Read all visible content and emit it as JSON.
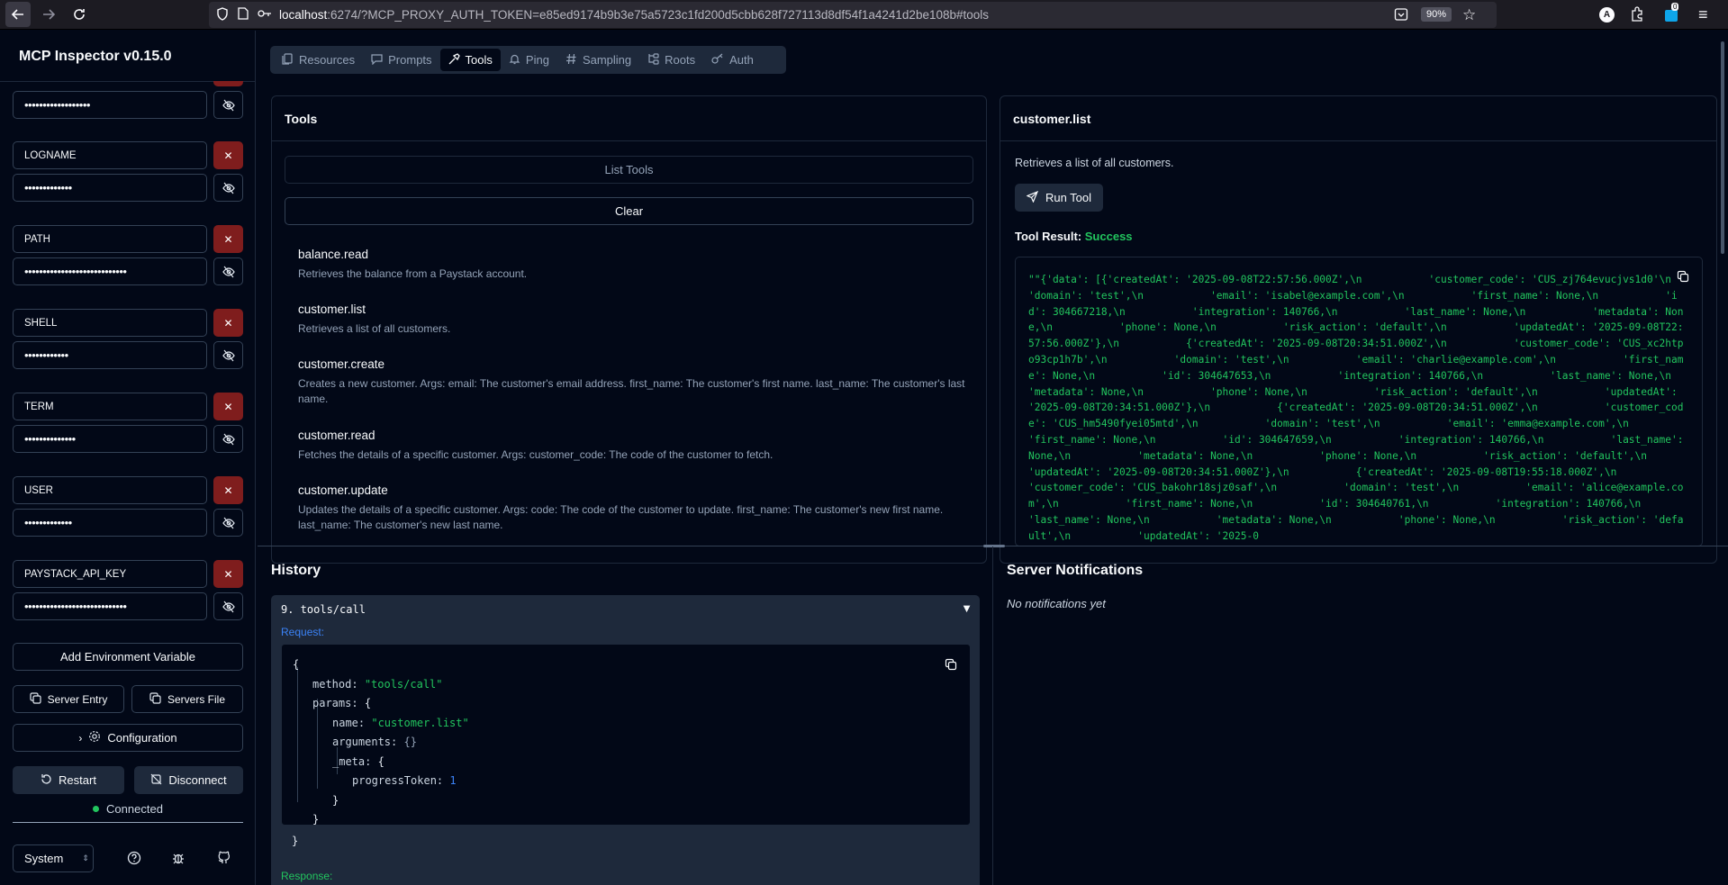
{
  "browser": {
    "url_host": "localhost",
    "url_rest": ":6274/?MCP_PROXY_AUTH_TOKEN=e85ed9174b9b3e75a5723c1fd200d5cbb628f727113d8df54f1a4241d2be108b#tools",
    "zoom": "90%",
    "ext_badge": "0"
  },
  "sidebar": {
    "title": "MCP Inspector v0.15.0",
    "env": [
      {
        "key": "",
        "value": "••••••••••••••••••"
      },
      {
        "key": "LOGNAME",
        "value": "•••••••••••••"
      },
      {
        "key": "PATH",
        "value": "••••••••••••••••••••••••••••"
      },
      {
        "key": "SHELL",
        "value": "••••••••••••"
      },
      {
        "key": "TERM",
        "value": "••••••••••••••"
      },
      {
        "key": "USER",
        "value": "•••••••••••••"
      },
      {
        "key": "PAYSTACK_API_KEY",
        "value": "••••••••••••••••••••••••••••"
      }
    ],
    "add_env": "Add Environment Variable",
    "server_entry": "Server Entry",
    "servers_file": "Servers File",
    "configuration": "Configuration",
    "restart": "Restart",
    "disconnect": "Disconnect",
    "status": "Connected",
    "theme": "System"
  },
  "tabs": [
    {
      "label": "Resources",
      "icon": "files-icon"
    },
    {
      "label": "Prompts",
      "icon": "message-icon"
    },
    {
      "label": "Tools",
      "icon": "hammer-icon"
    },
    {
      "label": "Ping",
      "icon": "bell-icon"
    },
    {
      "label": "Sampling",
      "icon": "hash-icon"
    },
    {
      "label": "Roots",
      "icon": "folder-tree-icon"
    },
    {
      "label": "Auth",
      "icon": "key-icon"
    }
  ],
  "tools_panel": {
    "title": "Tools",
    "list_tools": "List Tools",
    "clear": "Clear",
    "items": [
      {
        "name": "balance.read",
        "desc": "Retrieves the balance from a Paystack account."
      },
      {
        "name": "customer.list",
        "desc": "Retrieves a list of all customers."
      },
      {
        "name": "customer.create",
        "desc": "Creates a new customer. Args: email: The customer's email address. first_name: The customer's first name. last_name: The customer's last name."
      },
      {
        "name": "customer.read",
        "desc": "Fetches the details of a specific customer. Args: customer_code: The code of the customer to fetch."
      },
      {
        "name": "customer.update",
        "desc": "Updates the details of a specific customer. Args: code: The code of the customer to update. first_name: The customer's new first name. last_name: The customer's new last name."
      }
    ]
  },
  "detail_panel": {
    "title": "customer.list",
    "description": "Retrieves a list of all customers.",
    "run_tool": "Run Tool",
    "result_label": "Tool Result:",
    "result_status": "Success",
    "result_text": "\"\"{'data': [{'createdAt': '2025-09-08T22:57:56.000Z',\\n           'customer_code': 'CUS_zj764evucjvs1d0'\\n           'domain': 'test',\\n           'email': 'isabel@example.com',\\n           'first_name': None,\\n           'id': 304667218,\\n           'integration': 140766,\\n           'last_name': None,\\n           'metadata': None,\\n           'phone': None,\\n           'risk_action': 'default',\\n           'updatedAt': '2025-09-08T22:57:56.000Z'},\\n           {'createdAt': '2025-09-08T20:34:51.000Z',\\n           'customer_code': 'CUS_xc2htpo93cp1h7b',\\n           'domain': 'test',\\n           'email': 'charlie@example.com',\\n           'first_name': None,\\n           'id': 304647653,\\n           'integration': 140766,\\n           'last_name': None,\\n           'metadata': None,\\n           'phone': None,\\n           'risk_action': 'default',\\n           'updatedAt': '2025-09-08T20:34:51.000Z'},\\n           {'createdAt': '2025-09-08T20:34:51.000Z',\\n           'customer_code': 'CUS_hm5490fyei05mtd',\\n           'domain': 'test',\\n           'email': 'emma@example.com',\\n           'first_name': None,\\n           'id': 304647659,\\n           'integration': 140766,\\n           'last_name': None,\\n           'metadata': None,\\n           'phone': None,\\n           'risk_action': 'default',\\n           'updatedAt': '2025-09-08T20:34:51.000Z'},\\n           {'createdAt': '2025-09-08T19:55:18.000Z',\\n           'customer_code': 'CUS_bakohr18sjz0saf',\\n           'domain': 'test',\\n           'email': 'alice@example.com',\\n           'first_name': None,\\n           'id': 304640761,\\n           'integration': 140766,\\n           'last_name': None,\\n           'metadata': None,\\n           'phone': None,\\n           'risk_action': 'default',\\n           'updatedAt': '2025-0"
  },
  "history": {
    "title": "History",
    "entry": "9. tools/call",
    "request_label": "Request:",
    "response_label": "Response:",
    "json": {
      "open": "{",
      "method_key": "method:",
      "method_val": "\"tools/call\"",
      "params_key": "params:",
      "brace_open": "{",
      "name_key": "name:",
      "name_val": "\"customer.list\"",
      "args_key": "arguments:",
      "args_val": "{}",
      "meta_key": "_meta:",
      "token_key": "progressToken:",
      "token_val": "1",
      "close": "}"
    }
  },
  "notifications": {
    "title": "Server Notifications",
    "empty": "No notifications yet"
  },
  "colors": {
    "bg": "#020817",
    "border": "#1e293b",
    "success": "#22c55e",
    "danger": "#7f1d1d",
    "link": "#3b82f6"
  }
}
